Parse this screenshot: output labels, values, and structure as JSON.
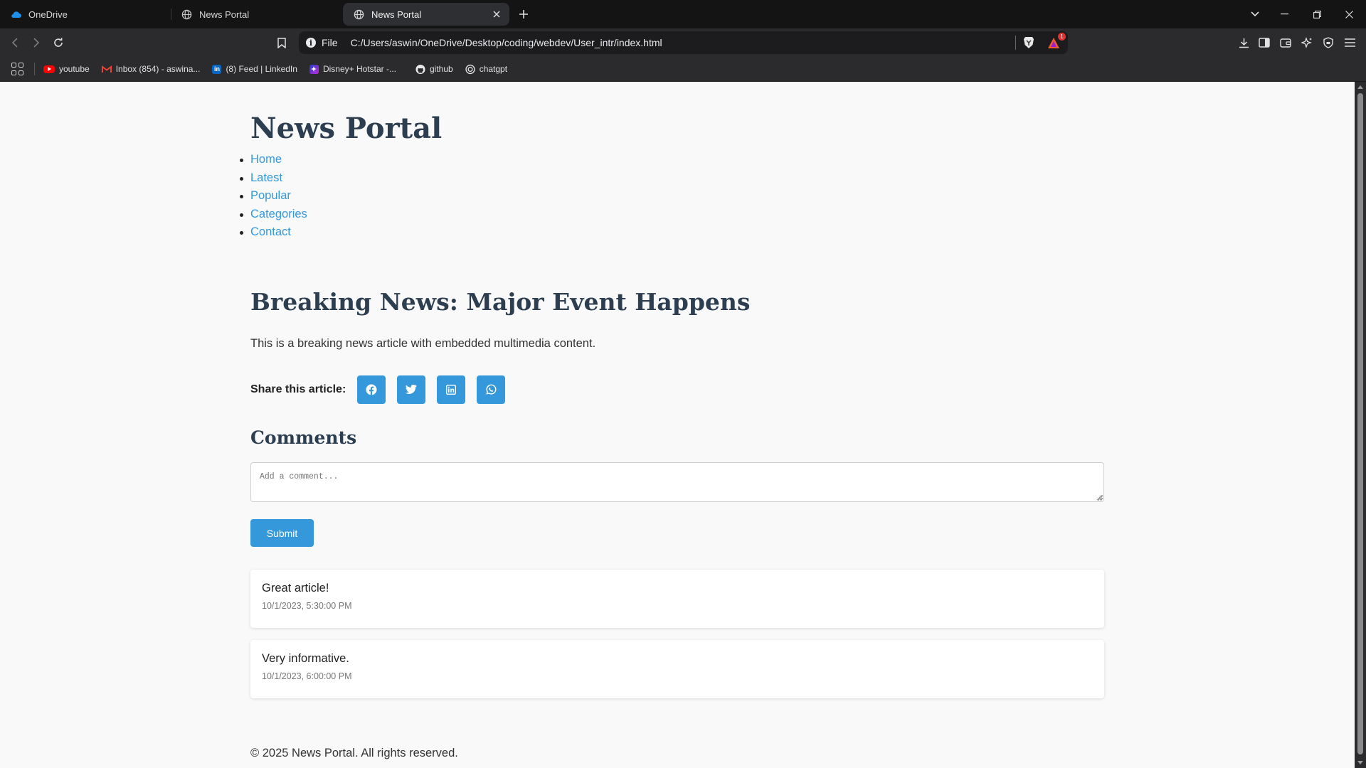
{
  "browser": {
    "tabs": [
      {
        "title": "OneDrive",
        "icon": "onedrive-icon",
        "active": false
      },
      {
        "title": "News Portal",
        "icon": "globe-icon",
        "active": false
      },
      {
        "title": "News Portal",
        "icon": "globe-icon",
        "active": true
      }
    ],
    "address": {
      "scheme_label": "File",
      "url": "C:/Users/aswin/OneDrive/Desktop/coding/webdev/User_intr/index.html"
    },
    "rewards_badge": "1",
    "bookmarks": [
      {
        "label": "youtube",
        "icon": "youtube-icon",
        "color": "#ff0000"
      },
      {
        "label": "Inbox (854) - aswina...",
        "icon": "gmail-icon",
        "color": "#ea4335"
      },
      {
        "label": "(8) Feed | LinkedIn",
        "icon": "linkedin-icon",
        "color": "#0a66c2"
      },
      {
        "label": "Disney+ Hotstar -...",
        "icon": "hotstar-icon",
        "color": "#5b2bd6"
      },
      {
        "label": "github",
        "icon": "github-icon",
        "color": "#ffffff"
      },
      {
        "label": "chatgpt",
        "icon": "chatgpt-icon",
        "color": "#ffffff"
      }
    ]
  },
  "page": {
    "site_title": "News Portal",
    "nav": [
      "Home",
      "Latest",
      "Popular",
      "Categories",
      "Contact"
    ],
    "article": {
      "title": "Breaking News: Major Event Happens",
      "body": "This is a breaking news article with embedded multimedia content."
    },
    "share": {
      "label": "Share this article:",
      "buttons": [
        "facebook-icon",
        "twitter-icon",
        "linkedin-icon",
        "whatsapp-icon"
      ]
    },
    "comments": {
      "title": "Comments",
      "placeholder": "Add a comment...",
      "submit_label": "Submit",
      "items": [
        {
          "text": "Great article!",
          "time": "10/1/2023, 5:30:00 PM"
        },
        {
          "text": "Very informative.",
          "time": "10/1/2023, 6:00:00 PM"
        }
      ]
    },
    "footer": "© 2025 News Portal. All rights reserved."
  },
  "colors": {
    "accent": "#3498db",
    "heading": "#2c3e50",
    "page_bg": "#f9f9f9"
  }
}
